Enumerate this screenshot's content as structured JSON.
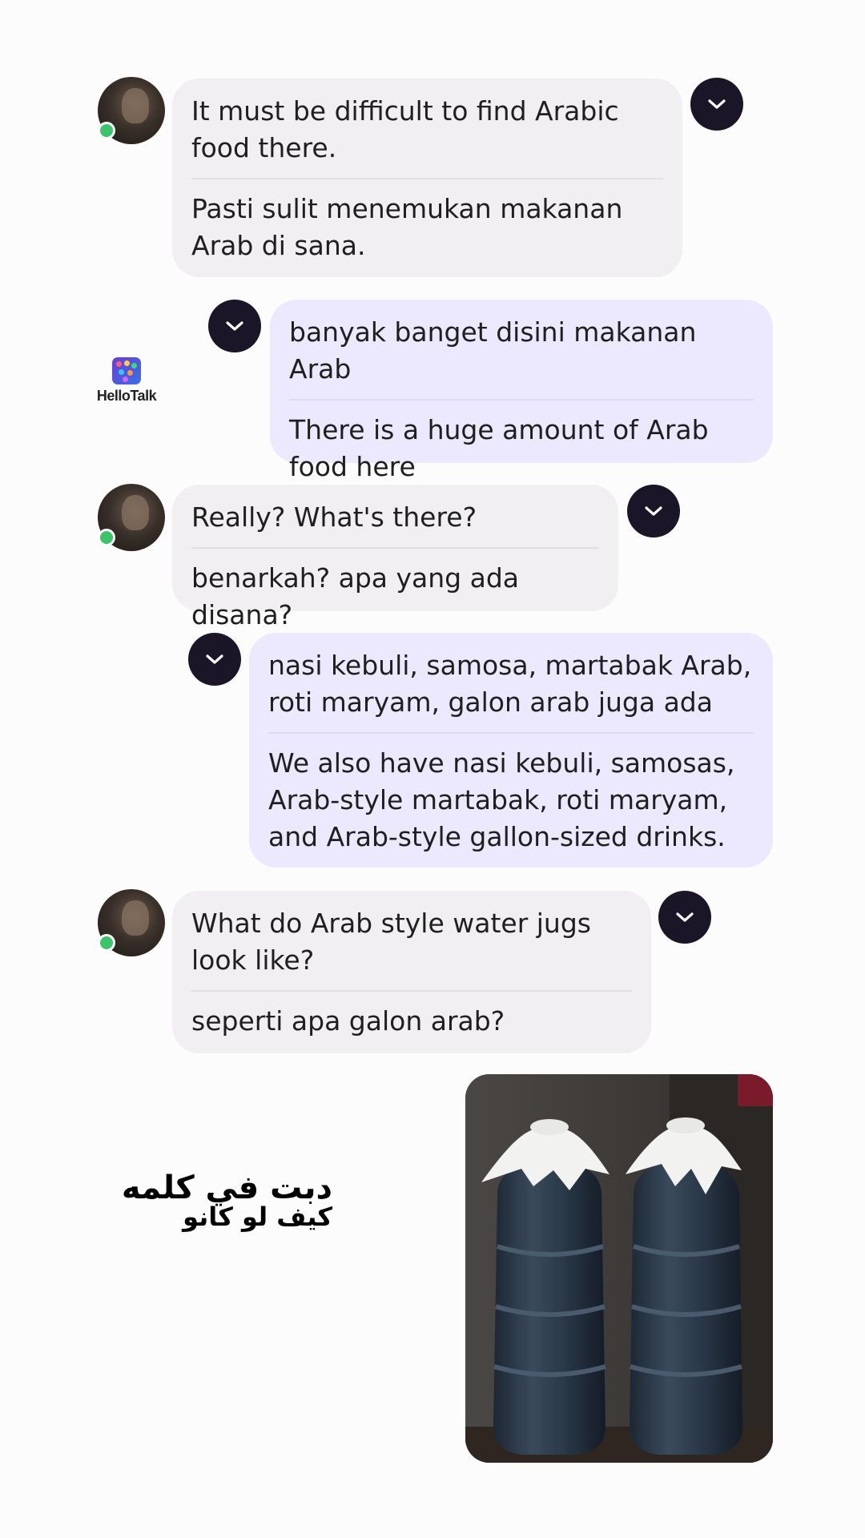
{
  "app": {
    "watermark_label": "HelloTalk"
  },
  "messages": [
    {
      "side": "incoming",
      "text": "It must be difficult to find Arabic food there.",
      "translation": "Pasti sulit menemukan makanan Arab di sana."
    },
    {
      "side": "outgoing",
      "text": "banyak banget disini makanan Arab",
      "translation": "There is a huge amount of Arab food here"
    },
    {
      "side": "incoming",
      "text": "Really? What's there?",
      "translation": "benarkah? apa yang ada disana?"
    },
    {
      "side": "outgoing",
      "text": "nasi kebuli, samosa, martabak Arab, roti maryam, galon arab juga ada",
      "translation": "We also have nasi kebuli, samosas, Arab-style martabak, roti maryam, and Arab-style gallon-sized drinks."
    },
    {
      "side": "incoming",
      "text": "What do Arab style water jugs look like?",
      "translation": "seperti apa galon arab?"
    }
  ],
  "overlay": {
    "line1": "دبت في كلمه",
    "line2": "كيف لو كانو"
  },
  "icons": {
    "avatar": "user-avatar",
    "online": "online-status-dot",
    "message_menu": "chevron-down-icon",
    "app_logo": "hellotalk-logo"
  },
  "colors": {
    "incoming_bubble": "#f1eff1",
    "outgoing_bubble": "#ece8fd",
    "chevron_button": "#1a1627",
    "online_dot": "#3cc36c"
  }
}
